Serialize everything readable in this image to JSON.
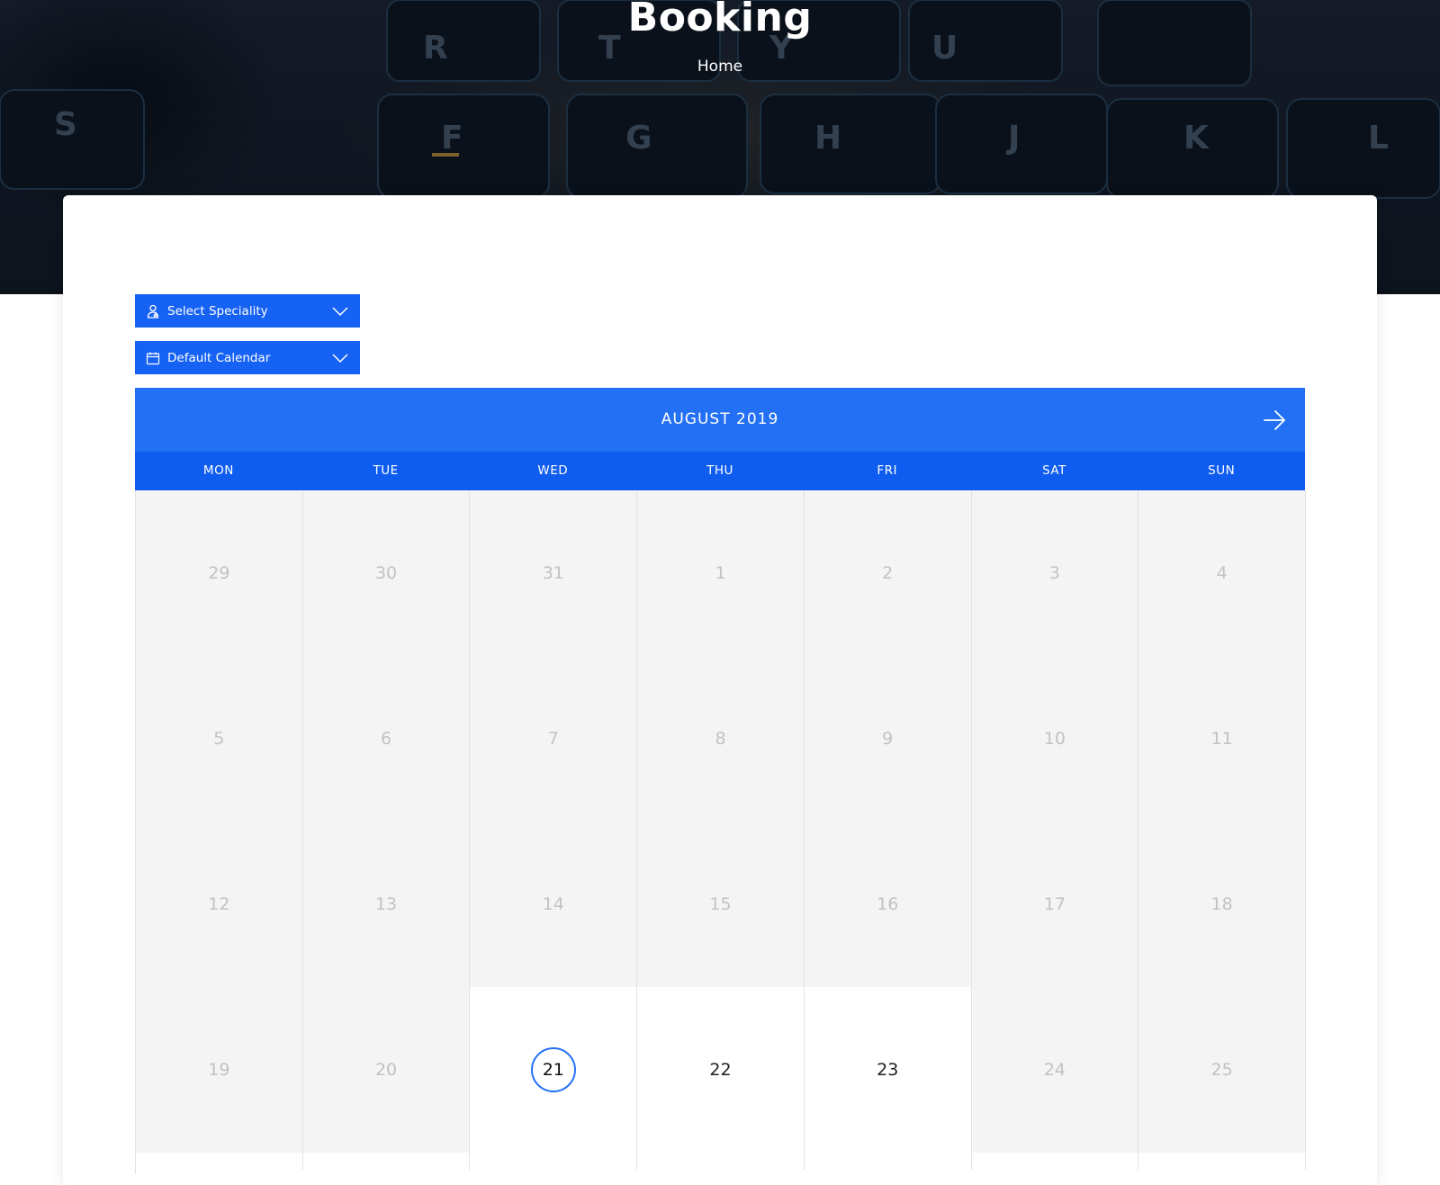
{
  "hero": {
    "title": "Booking",
    "breadcrumb": "Home"
  },
  "filters": {
    "speciality": {
      "label": "Select Speciality",
      "icon": "doctor-icon"
    },
    "calendar": {
      "label": "Default Calendar",
      "icon": "calendar-icon"
    }
  },
  "calendar": {
    "month_label": "AUGUST 2019",
    "next_icon": "arrow-right-icon",
    "weekdays": [
      "MON",
      "TUE",
      "WED",
      "THU",
      "FRI",
      "SAT",
      "SUN"
    ],
    "selected_day": 21,
    "weeks": [
      [
        {
          "d": "29",
          "state": "disabled"
        },
        {
          "d": "30",
          "state": "disabled"
        },
        {
          "d": "31",
          "state": "disabled"
        },
        {
          "d": "1",
          "state": "disabled"
        },
        {
          "d": "2",
          "state": "disabled"
        },
        {
          "d": "3",
          "state": "disabled"
        },
        {
          "d": "4",
          "state": "disabled"
        }
      ],
      [
        {
          "d": "5",
          "state": "disabled"
        },
        {
          "d": "6",
          "state": "disabled"
        },
        {
          "d": "7",
          "state": "disabled"
        },
        {
          "d": "8",
          "state": "disabled"
        },
        {
          "d": "9",
          "state": "disabled"
        },
        {
          "d": "10",
          "state": "disabled"
        },
        {
          "d": "11",
          "state": "disabled"
        }
      ],
      [
        {
          "d": "12",
          "state": "disabled"
        },
        {
          "d": "13",
          "state": "disabled"
        },
        {
          "d": "14",
          "state": "disabled"
        },
        {
          "d": "15",
          "state": "disabled"
        },
        {
          "d": "16",
          "state": "disabled"
        },
        {
          "d": "17",
          "state": "disabled"
        },
        {
          "d": "18",
          "state": "disabled"
        }
      ],
      [
        {
          "d": "19",
          "state": "disabled"
        },
        {
          "d": "20",
          "state": "disabled"
        },
        {
          "d": "21",
          "state": "selected"
        },
        {
          "d": "22",
          "state": "available"
        },
        {
          "d": "23",
          "state": "available"
        },
        {
          "d": "24",
          "state": "disabled"
        },
        {
          "d": "25",
          "state": "disabled"
        }
      ]
    ]
  },
  "colors": {
    "accent": "#2370f5",
    "weekday_bar": "#0f5df0",
    "select_bg": "#1662f4",
    "disabled_cell": "#f4f4f4"
  }
}
